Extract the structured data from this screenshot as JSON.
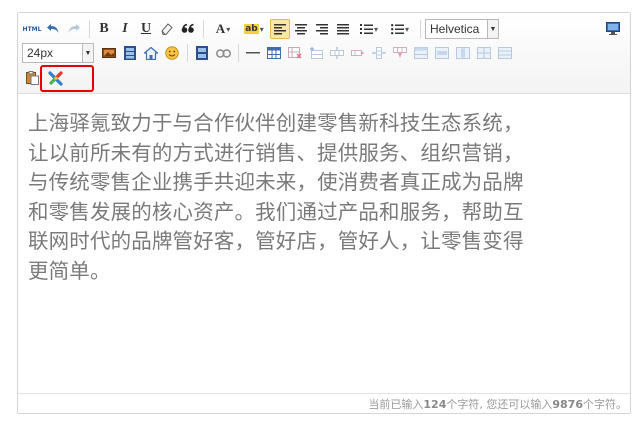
{
  "toolbar": {
    "source_label": "HTML",
    "bold_label": "B",
    "italic_label": "I",
    "underline_label": "U",
    "fontcolor_label": "A",
    "backcolor_label": "ab",
    "font_family": "Helvetica",
    "font_size": "24px",
    "icons": [
      "html-source-icon",
      "undo-icon",
      "redo-icon",
      "bold-icon",
      "italic-icon",
      "underline-icon",
      "eraser-icon",
      "blockquote-icon",
      "font-color-icon",
      "highlight-icon",
      "align-left-icon",
      "align-center-icon",
      "align-right-icon",
      "align-justify-icon",
      "ordered-list-icon",
      "unordered-list-icon",
      "fullscreen-icon",
      "image-icon",
      "video-icon",
      "map-icon",
      "emotion-icon",
      "pagebreak-icon",
      "link-icon",
      "horizontal-rule-icon",
      "insert-table-icon",
      "paste-plain-icon",
      "clear-format-icon"
    ]
  },
  "content": {
    "lines": [
      "上海驿氪致力于与合作伙伴创建零售新科技生态系统，",
      "让以前所未有的方式进行销售、提供服务、组织营销，",
      "与传统零售企业携手共迎未来，使消费者真正成为品牌",
      "和零售发展的核心资产。我们通过产品和服务，帮助互",
      "联网时代的品牌管好客，管好店，管好人，让零售变得",
      "更简单。"
    ]
  },
  "status": {
    "prefix": "当前已输入",
    "typed_count": "124",
    "middle": "个字符, 您还可以输入",
    "remaining_count": "9876",
    "suffix": "个字符。"
  },
  "colors": {
    "active_bg": "#fbe6a9",
    "highlight_border": "#e60000",
    "text": "#7a7a7a",
    "icon_blue": "#3a6fb0"
  }
}
